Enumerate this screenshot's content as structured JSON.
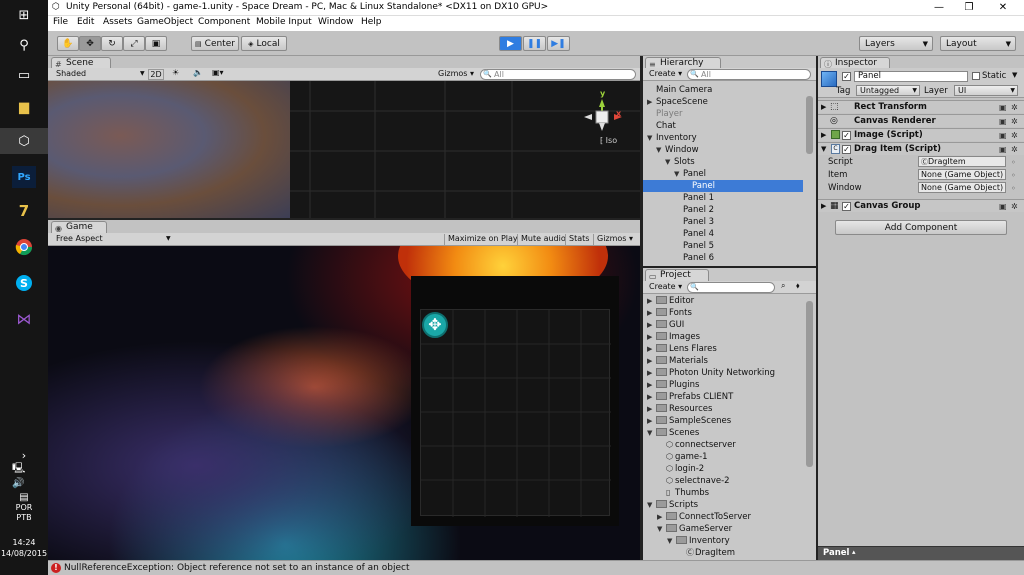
{
  "window": {
    "title": "Unity Personal (64bit) - game-1.unity - Space Dream - PC, Mac & Linux Standalone* <DX11 on DX10 GPU>"
  },
  "menubar": [
    "File",
    "Edit",
    "Assets",
    "GameObject",
    "Component",
    "Mobile Input",
    "Window",
    "Help"
  ],
  "toolbar": {
    "pivot": "Center",
    "space": "Local",
    "layers": "Layers",
    "layout": "Layout"
  },
  "taskbar": {
    "lang1": "POR",
    "lang2": "PTB",
    "time": "14:24",
    "date": "14/08/2015"
  },
  "scene": {
    "tab": "Scene",
    "shading": "Shaded",
    "mode2d": "2D",
    "gizmos": "Gizmos",
    "search": "All",
    "gizmo_y": "y",
    "gizmo_x": "x",
    "gizmo_iso": "Iso"
  },
  "game": {
    "tab": "Game",
    "aspect": "Free Aspect",
    "maximize": "Maximize on Play",
    "mute": "Mute audio",
    "stats": "Stats",
    "gizmos": "Gizmos"
  },
  "hierarchy": {
    "tab": "Hierarchy",
    "create": "Create",
    "search": "All",
    "rows": [
      {
        "label": "Main Camera",
        "indent": 0,
        "arrow": ""
      },
      {
        "label": "SpaceScene",
        "indent": 0,
        "arrow": "▶"
      },
      {
        "label": "Player",
        "indent": 0,
        "arrow": "",
        "dim": true
      },
      {
        "label": "Chat",
        "indent": 0,
        "arrow": ""
      },
      {
        "label": "Inventory",
        "indent": 0,
        "arrow": "▼"
      },
      {
        "label": "Window",
        "indent": 1,
        "arrow": "▼"
      },
      {
        "label": "Slots",
        "indent": 2,
        "arrow": "▼"
      },
      {
        "label": "Panel",
        "indent": 3,
        "arrow": "▼"
      },
      {
        "label": "Panel",
        "indent": 4,
        "arrow": "",
        "selected": true
      },
      {
        "label": "Panel 1",
        "indent": 3,
        "arrow": ""
      },
      {
        "label": "Panel 2",
        "indent": 3,
        "arrow": ""
      },
      {
        "label": "Panel 3",
        "indent": 3,
        "arrow": ""
      },
      {
        "label": "Panel 4",
        "indent": 3,
        "arrow": ""
      },
      {
        "label": "Panel 5",
        "indent": 3,
        "arrow": ""
      },
      {
        "label": "Panel 6",
        "indent": 3,
        "arrow": ""
      }
    ]
  },
  "project": {
    "tab": "Project",
    "create": "Create",
    "rows": [
      {
        "label": "Editor",
        "indent": 0,
        "kind": "folder",
        "arrow": "▶"
      },
      {
        "label": "Fonts",
        "indent": 0,
        "kind": "folder",
        "arrow": "▶"
      },
      {
        "label": "GUI",
        "indent": 0,
        "kind": "folder",
        "arrow": "▶"
      },
      {
        "label": "Images",
        "indent": 0,
        "kind": "folder",
        "arrow": "▶"
      },
      {
        "label": "Lens Flares",
        "indent": 0,
        "kind": "folder",
        "arrow": "▶"
      },
      {
        "label": "Materials",
        "indent": 0,
        "kind": "folder",
        "arrow": "▶"
      },
      {
        "label": "Photon Unity Networking",
        "indent": 0,
        "kind": "folder",
        "arrow": "▶"
      },
      {
        "label": "Plugins",
        "indent": 0,
        "kind": "folder",
        "arrow": "▶"
      },
      {
        "label": "Prefabs CLIENT",
        "indent": 0,
        "kind": "folder",
        "arrow": "▶"
      },
      {
        "label": "Resources",
        "indent": 0,
        "kind": "folder",
        "arrow": "▶"
      },
      {
        "label": "SampleScenes",
        "indent": 0,
        "kind": "folder",
        "arrow": "▶"
      },
      {
        "label": "Scenes",
        "indent": 0,
        "kind": "folder",
        "arrow": "▼"
      },
      {
        "label": "connectserver",
        "indent": 1,
        "kind": "scene",
        "arrow": ""
      },
      {
        "label": "game-1",
        "indent": 1,
        "kind": "scene",
        "arrow": ""
      },
      {
        "label": "login-2",
        "indent": 1,
        "kind": "scene",
        "arrow": ""
      },
      {
        "label": "selectnave-2",
        "indent": 1,
        "kind": "scene",
        "arrow": ""
      },
      {
        "label": "Thumbs",
        "indent": 1,
        "kind": "file",
        "arrow": ""
      },
      {
        "label": "Scripts",
        "indent": 0,
        "kind": "folder",
        "arrow": "▼"
      },
      {
        "label": "ConnectToServer",
        "indent": 1,
        "kind": "folder",
        "arrow": "▶"
      },
      {
        "label": "GameServer",
        "indent": 1,
        "kind": "folder",
        "arrow": "▼"
      },
      {
        "label": "Inventory",
        "indent": 2,
        "kind": "folder",
        "arrow": "▼"
      },
      {
        "label": "DragItem",
        "indent": 3,
        "kind": "script",
        "arrow": ""
      }
    ]
  },
  "inspector": {
    "tab": "Inspector",
    "object_name": "Panel",
    "static": "Static",
    "tag_label": "Tag",
    "tag": "Untagged",
    "layer_label": "Layer",
    "layer": "UI",
    "components": {
      "rect": "Rect Transform",
      "canvas_renderer": "Canvas Renderer",
      "image": "Image (Script)",
      "drag": "Drag Item (Script)",
      "canvas_group": "Canvas Group"
    },
    "props": {
      "script_label": "Script",
      "script_value": "DragItem",
      "item_label": "Item",
      "item_value": "None (Game Object)",
      "window_label": "Window",
      "window_value": "None (Game Object)"
    },
    "add_component": "Add Component",
    "footer": "Panel"
  },
  "status": {
    "message": "NullReferenceException: Object reference not set to an instance of an object"
  },
  "colors": {
    "selection": "#3d7bd6",
    "play_active": "#2f7de1",
    "error": "#cc2020",
    "move_icon": "#1aa7a7"
  }
}
